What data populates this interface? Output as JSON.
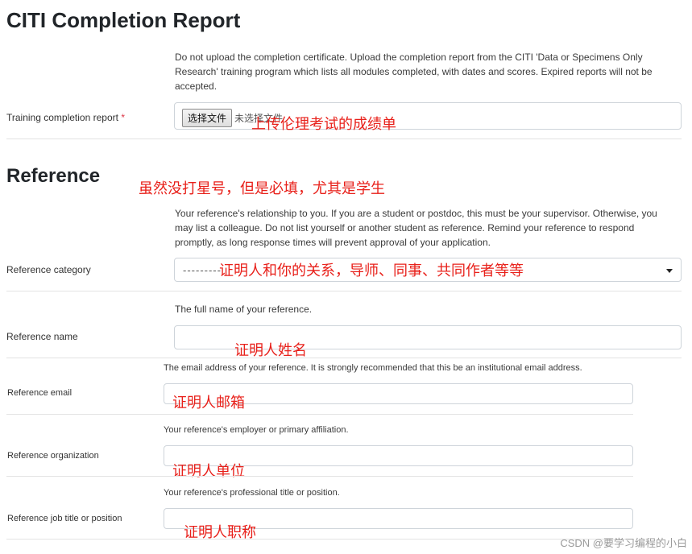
{
  "page": {
    "title": "CITI Completion Report",
    "reference_heading": "Reference"
  },
  "training": {
    "help": "Do not upload the completion certificate. Upload the completion report from the CITI 'Data or Specimens Only Research' training program which lists all modules completed, with dates and scores. Expired reports will not be accepted.",
    "label": "Training completion report",
    "required_mark": "*",
    "file_button": "选择文件",
    "file_status": "未选择文件"
  },
  "reference_category": {
    "help": "Your reference's relationship to you. If you are a student or postdoc, this must be your supervisor. Otherwise, you may list a colleague. Do not list yourself or another student as reference. Remind your reference to respond promptly, as long response times will prevent approval of your application.",
    "label": "Reference category",
    "selected": "---------"
  },
  "reference_name": {
    "help": "The full name of your reference.",
    "label": "Reference name"
  },
  "reference_email": {
    "help": "The email address of your reference. It is strongly recommended that this be an institutional email address.",
    "label": "Reference email"
  },
  "reference_org": {
    "help": "Your reference's employer or primary affiliation.",
    "label": "Reference organization"
  },
  "reference_job": {
    "help": "Your reference's professional title or position.",
    "label": "Reference job title or position"
  },
  "annotations": {
    "upload": "上传伦理考试的成绩单",
    "required_note": "虽然没打星号，但是必填，尤其是学生",
    "category": "证明人和你的关系，导师、同事、共同作者等等",
    "name": "证明人姓名",
    "email": "证明人邮箱",
    "org": "证明人单位",
    "job": "证明人职称"
  },
  "watermark": "CSDN @要学习编程的小白",
  "colors": {
    "annotation": "#e8201a",
    "required": "#dc3545",
    "border": "#ced4da"
  }
}
